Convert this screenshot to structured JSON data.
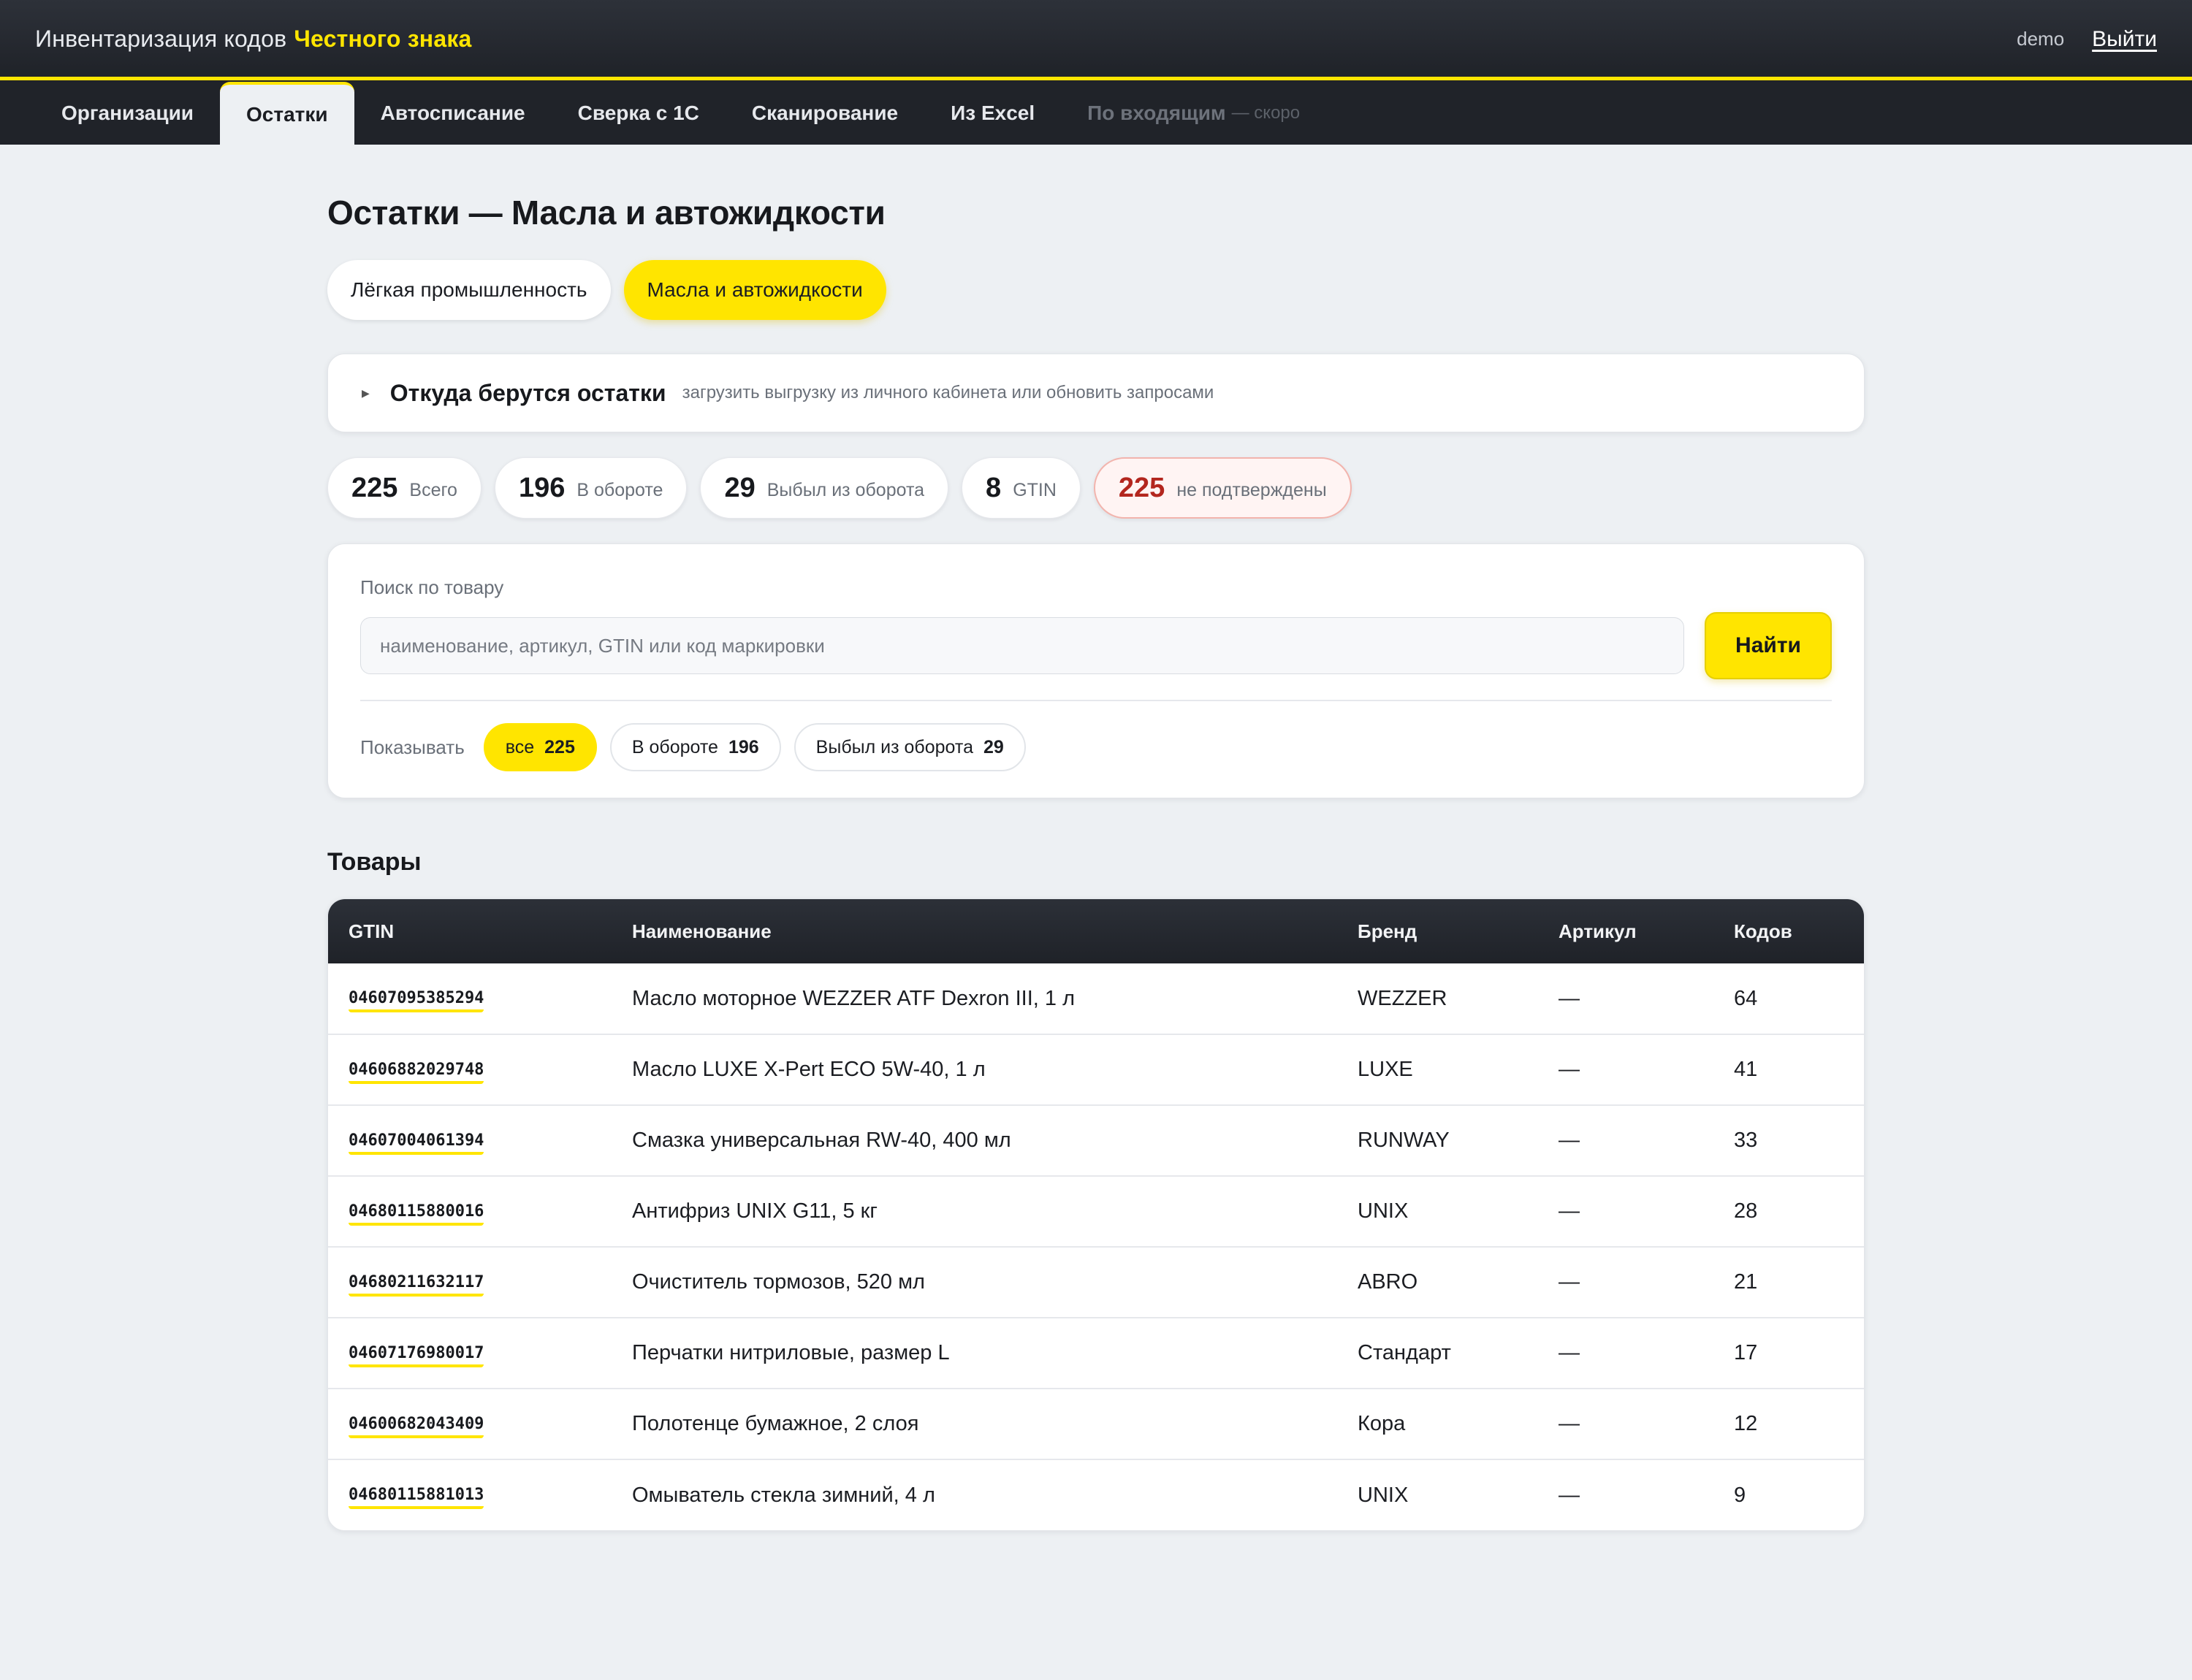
{
  "header": {
    "title_prefix": "Инвентаризация кодов",
    "title_brand": "Честного знака",
    "user": "demo",
    "logout": "Выйти"
  },
  "nav": {
    "tabs": [
      {
        "label": "Организации"
      },
      {
        "label": "Остатки",
        "active": true
      },
      {
        "label": "Автосписание"
      },
      {
        "label": "Сверка с 1С"
      },
      {
        "label": "Сканирование"
      },
      {
        "label": "Из Excel"
      },
      {
        "label": "По входящим",
        "suffix": "— скоро",
        "disabled": true
      }
    ]
  },
  "page": {
    "title": "Остатки — Масла и автожидкости",
    "categories": [
      {
        "label": "Лёгкая промышленность"
      },
      {
        "label": "Масла и автожидкости",
        "active": true
      }
    ],
    "source": {
      "title": "Откуда берутся остатки",
      "hint": "загрузить выгрузку из личного кабинета или обновить запросами"
    },
    "stats": [
      {
        "value": "225",
        "label": "Всего"
      },
      {
        "value": "196",
        "label": "В обороте"
      },
      {
        "value": "29",
        "label": "Выбыл из оборота"
      },
      {
        "value": "8",
        "label": "GTIN"
      },
      {
        "value": "225",
        "label": "не подтверждены"
      }
    ],
    "search": {
      "label": "Поиск по товару",
      "placeholder": "наименование, артикул, GTIN или код маркировки",
      "value": "",
      "button": "Найти"
    },
    "filter": {
      "label": "Показывать",
      "options": [
        {
          "label": "все",
          "count": "225",
          "active": true
        },
        {
          "label": "В обороте",
          "count": "196"
        },
        {
          "label": "Выбыл из оборота",
          "count": "29"
        }
      ]
    },
    "products_title": "Товары",
    "table": {
      "columns": [
        "GTIN",
        "Наименование",
        "Бренд",
        "Артикул",
        "Кодов"
      ],
      "rows": [
        {
          "gtin": "04607095385294",
          "name": "Масло моторное WEZZER ATF Dexron III, 1 л",
          "brand": "WEZZER",
          "article": "—",
          "codes": "64"
        },
        {
          "gtin": "04606882029748",
          "name": "Масло LUXE X-Pert ECO 5W-40, 1 л",
          "brand": "LUXE",
          "article": "—",
          "codes": "41"
        },
        {
          "gtin": "04607004061394",
          "name": "Смазка универсальная RW-40, 400 мл",
          "brand": "RUNWAY",
          "article": "—",
          "codes": "33"
        },
        {
          "gtin": "04680115880016",
          "name": "Антифриз UNIX G11, 5 кг",
          "brand": "UNIX",
          "article": "—",
          "codes": "28"
        },
        {
          "gtin": "04680211632117",
          "name": "Очиститель тормозов, 520 мл",
          "brand": "ABRO",
          "article": "—",
          "codes": "21"
        },
        {
          "gtin": "04607176980017",
          "name": "Перчатки нитриловые, размер L",
          "brand": "Стандарт",
          "article": "—",
          "codes": "17"
        },
        {
          "gtin": "04600682043409",
          "name": "Полотенце бумажное, 2 слоя",
          "brand": "Кора",
          "article": "—",
          "codes": "12"
        },
        {
          "gtin": "04680115881013",
          "name": "Омыватель стекла зимний, 4 л",
          "brand": "UNIX",
          "article": "—",
          "codes": "9"
        }
      ]
    }
  },
  "colors": {
    "accent": "#ffe500",
    "header_bg": "#23262c",
    "page_bg": "#edf0f3",
    "warn": "#b3261e"
  }
}
